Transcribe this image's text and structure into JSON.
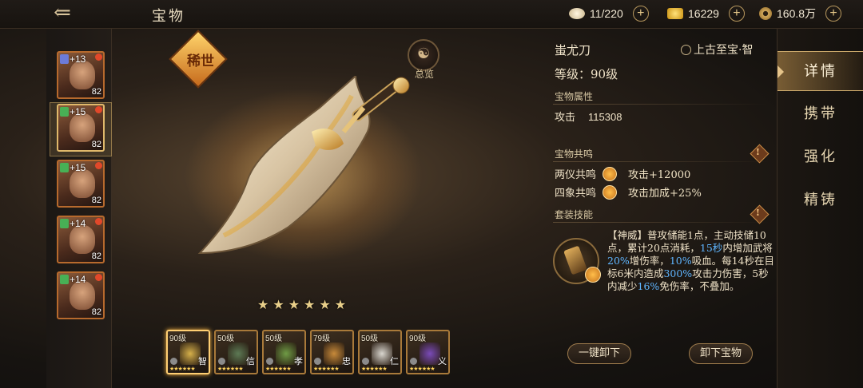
{
  "header": {
    "back_icon": "back-arrow-icon",
    "title": "宝物",
    "resources": [
      {
        "icon": "silver-ingot-icon",
        "value": "11/220",
        "color": "#e9d9b8"
      },
      {
        "icon": "gold-ingot-icon",
        "value": "16229",
        "color": "#f2c445"
      },
      {
        "icon": "copper-coin-icon",
        "value": "160.8万",
        "color": "#c9a45a"
      }
    ]
  },
  "heroes": [
    {
      "plus": "+13",
      "level": "82",
      "badge_color": "#6c7bd8",
      "selected": false
    },
    {
      "plus": "+15",
      "level": "82",
      "badge_color": "#48b055",
      "selected": true
    },
    {
      "plus": "+15",
      "level": "82",
      "badge_color": "#48b055",
      "selected": false
    },
    {
      "plus": "+14",
      "level": "82",
      "badge_color": "#48b055",
      "selected": false
    },
    {
      "plus": "+14",
      "level": "82",
      "badge_color": "#48b055",
      "selected": false
    }
  ],
  "center": {
    "rarity_label": "稀世",
    "overview_label": "总览",
    "star_count": 6
  },
  "equipment": [
    {
      "level": "90级",
      "tag": "智",
      "color": "#d6b04a",
      "selected": true
    },
    {
      "level": "50级",
      "tag": "信",
      "color": "#5d7a55",
      "selected": false
    },
    {
      "level": "50级",
      "tag": "孝",
      "color": "#6f9b45",
      "selected": false
    },
    {
      "level": "79级",
      "tag": "忠",
      "color": "#c88a3a",
      "selected": false
    },
    {
      "level": "50级",
      "tag": "仁",
      "color": "#d9d6cf",
      "selected": false
    },
    {
      "level": "90级",
      "tag": "义",
      "color": "#7a4bb8",
      "selected": false
    }
  ],
  "detail": {
    "name": "蚩尤刀",
    "rank": "上古至宝·智",
    "level": "等级：90级",
    "attr_title": "宝物属性",
    "attr_name": "攻击",
    "attr_value": "115308",
    "resonance_title": "宝物共鸣",
    "resonances": [
      {
        "name": "两仪共鸣",
        "effect": "攻击+12000"
      },
      {
        "name": "四象共鸣",
        "effect": "攻击加成+25%"
      }
    ],
    "set_title": "套装技能",
    "skill": {
      "name": "【神威】",
      "text_parts": [
        {
          "t": "普攻储能1点，主动技储10点，累计20点消耗，",
          "hl": false
        },
        {
          "t": "15秒",
          "hl": true
        },
        {
          "t": "内增加武将",
          "hl": false
        },
        {
          "t": "20%",
          "hl": true
        },
        {
          "t": "增伤率，",
          "hl": false
        },
        {
          "t": "10%",
          "hl": true
        },
        {
          "t": "吸血。每14秒在目标6米内造成",
          "hl": false
        },
        {
          "t": "300%",
          "hl": true
        },
        {
          "t": "攻击力伤害，5秒内减少",
          "hl": false
        },
        {
          "t": "16%",
          "hl": true
        },
        {
          "t": "免伤率，不叠加。",
          "hl": false
        }
      ]
    },
    "btn_unequip_all": "一键卸下",
    "btn_unequip": "卸下宝物"
  },
  "tabs": [
    {
      "label": "详情",
      "active": true
    },
    {
      "label": "携带",
      "active": false
    },
    {
      "label": "强化",
      "active": false
    },
    {
      "label": "精铸",
      "active": false
    }
  ]
}
